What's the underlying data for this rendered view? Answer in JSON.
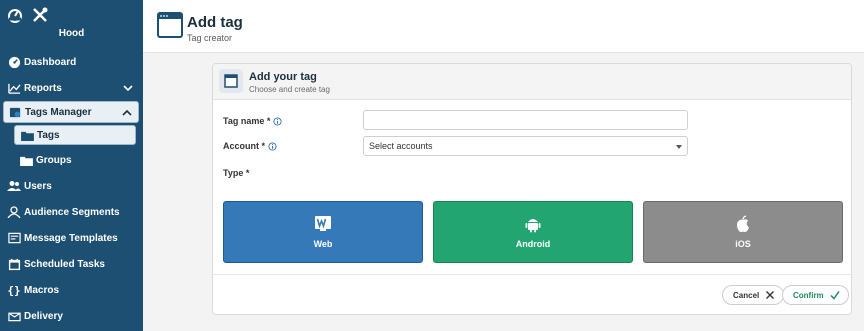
{
  "sidebar": {
    "user_name": "Hood",
    "items": [
      {
        "label": "Dashboard",
        "icon": "dashboard-icon"
      },
      {
        "label": "Reports",
        "icon": "chart-line-icon",
        "expandable": true
      },
      {
        "label": "Tags Manager",
        "icon": "tags-manager-icon",
        "expandable": true,
        "expanded": true
      },
      {
        "label": "Tags",
        "icon": "folder-icon",
        "active": true
      },
      {
        "label": "Groups",
        "icon": "folder-icon"
      },
      {
        "label": "Users",
        "icon": "users-icon"
      },
      {
        "label": "Audience Segments",
        "icon": "audience-icon"
      },
      {
        "label": "Message Templates",
        "icon": "message-templates-icon"
      },
      {
        "label": "Scheduled Tasks",
        "icon": "calendar-icon"
      },
      {
        "label": "Macros",
        "icon": "braces-icon"
      },
      {
        "label": "Delivery",
        "icon": "delivery-icon"
      }
    ]
  },
  "header": {
    "title": "Add tag",
    "subtitle": "Tag creator"
  },
  "card": {
    "title": "Add your tag",
    "subtitle": "Choose and create tag",
    "fields": {
      "tag_name_label": "Tag name *",
      "tag_name_value": "",
      "account_label": "Account *",
      "account_value": "Select accounts",
      "type_label": "Type *"
    },
    "types": [
      {
        "label": "Web",
        "color": "#3579b8"
      },
      {
        "label": "Android",
        "color": "#22a571"
      },
      {
        "label": "iOS",
        "color": "#8c8c8d"
      }
    ],
    "actions": {
      "cancel": "Cancel",
      "confirm": "Confirm"
    }
  },
  "colors": {
    "sidebar": "#1d4f72",
    "web": "#3579b8",
    "android": "#22a571",
    "ios": "#8c8c8d",
    "confirm": "#1d8a5c"
  }
}
